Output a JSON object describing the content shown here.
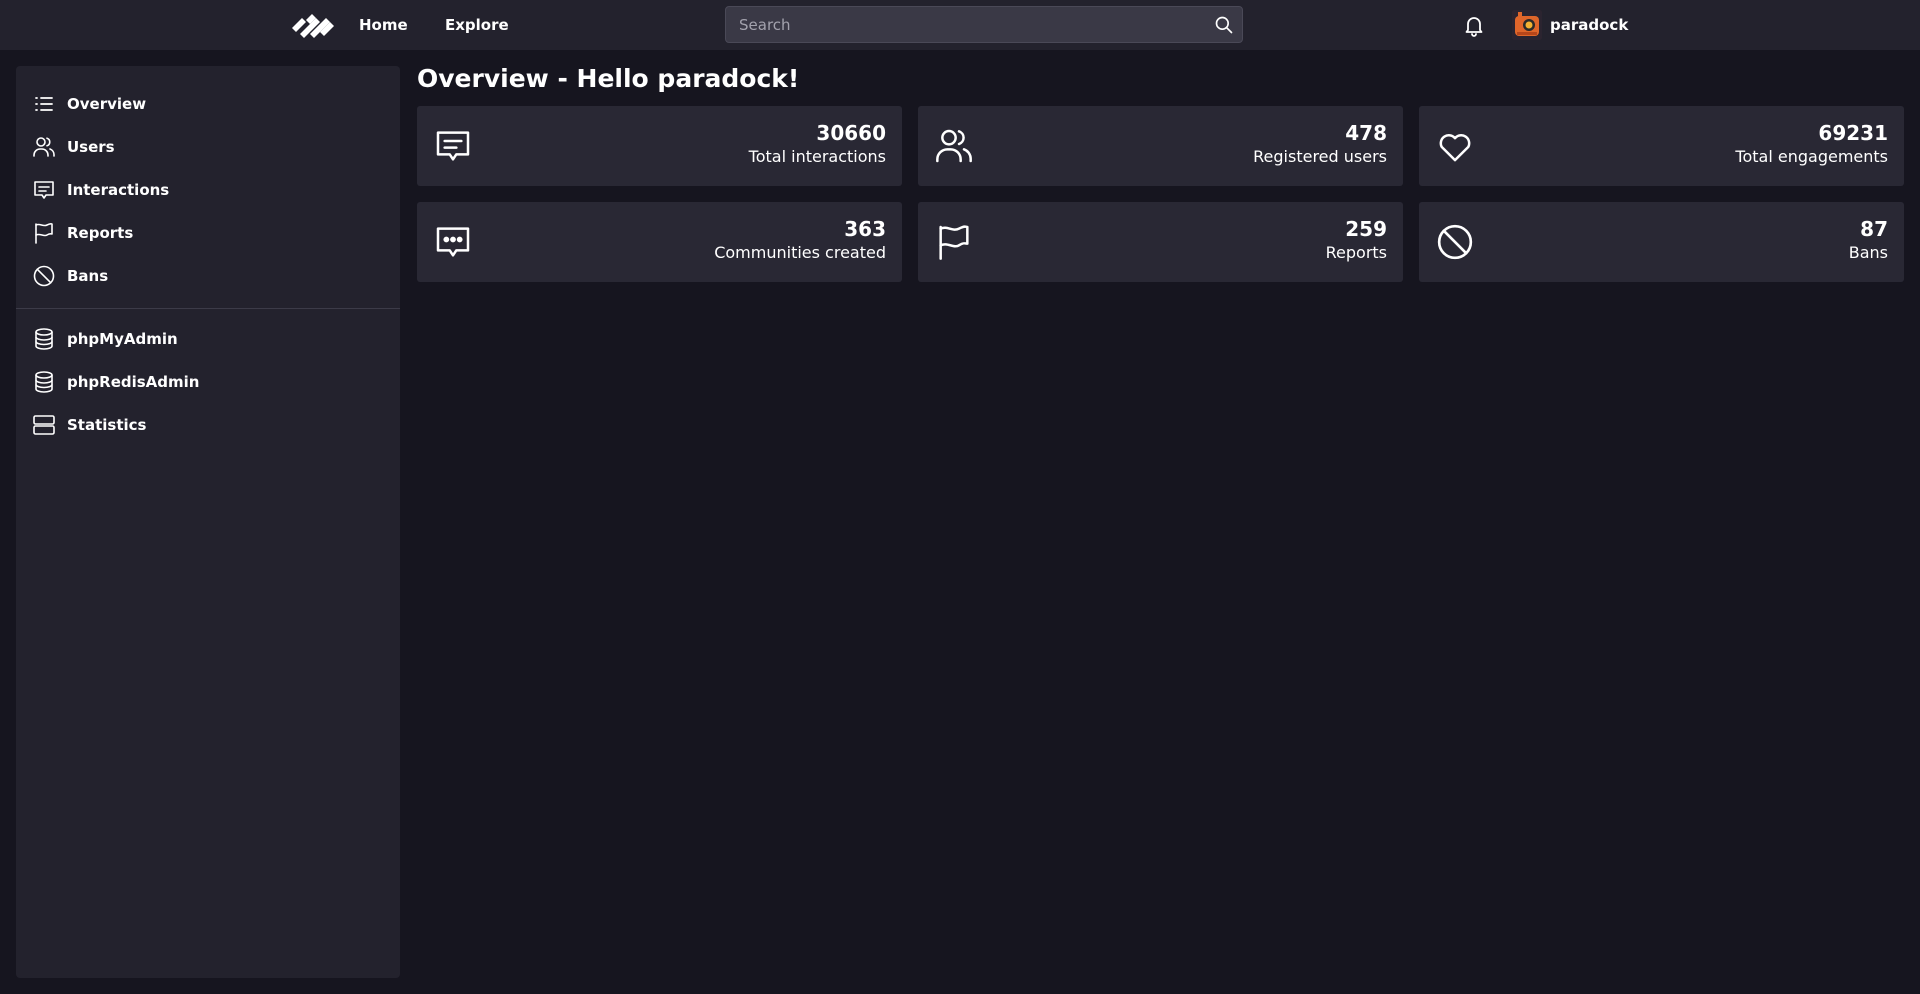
{
  "topbar": {
    "nav": {
      "home": "Home",
      "explore": "Explore"
    },
    "search": {
      "placeholder": "Search"
    },
    "user": {
      "name": "paradock"
    }
  },
  "sidebar": {
    "items": [
      {
        "label": "Overview",
        "icon": "list-icon"
      },
      {
        "label": "Users",
        "icon": "users-icon"
      },
      {
        "label": "Interactions",
        "icon": "message-icon"
      },
      {
        "label": "Reports",
        "icon": "flag-icon"
      },
      {
        "label": "Bans",
        "icon": "ban-icon"
      }
    ],
    "tools": [
      {
        "label": "phpMyAdmin",
        "icon": "database-icon"
      },
      {
        "label": "phpRedisAdmin",
        "icon": "database-icon"
      },
      {
        "label": "Statistics",
        "icon": "server-icon"
      }
    ]
  },
  "main": {
    "title": "Overview - Hello paradock!",
    "stats": [
      {
        "value": "30660",
        "label": "Total interactions",
        "icon": "message-icon"
      },
      {
        "value": "478",
        "label": "Registered users",
        "icon": "users-icon"
      },
      {
        "value": "69231",
        "label": "Total engagements",
        "icon": "heart-icon"
      },
      {
        "value": "363",
        "label": "Communities created",
        "icon": "message-dots-icon"
      },
      {
        "value": "259",
        "label": "Reports",
        "icon": "flag-icon"
      },
      {
        "value": "87",
        "label": "Bans",
        "icon": "ban-icon"
      }
    ]
  },
  "colors": {
    "background": "#16151f",
    "panel": "#23222d",
    "card": "#292834",
    "text": "#ffffff"
  }
}
